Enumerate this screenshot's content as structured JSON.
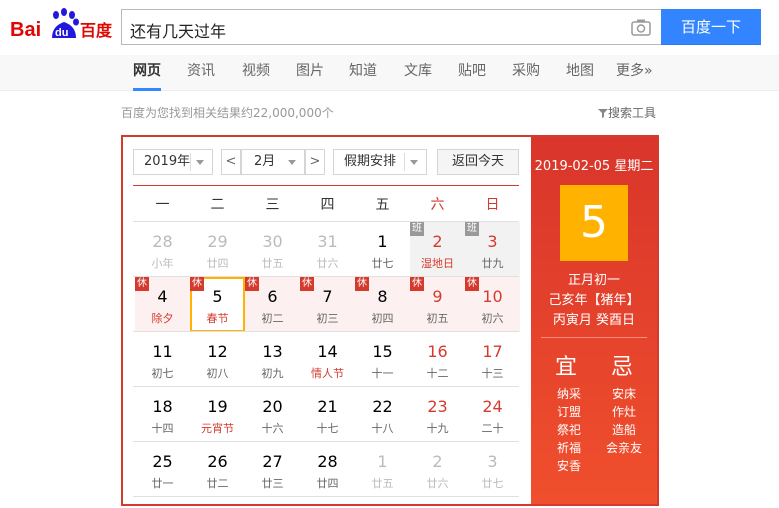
{
  "header": {
    "logo_text_bai": "Bai",
    "logo_text_du": "du",
    "logo_text_cn": "百度",
    "search_value": "还有几天过年",
    "search_button": "百度一下"
  },
  "tabs": [
    "网页",
    "资讯",
    "视频",
    "图片",
    "知道",
    "文库",
    "贴吧",
    "采购",
    "地图",
    "更多»"
  ],
  "result_count": "百度为您找到相关结果约22,000,000个",
  "search_tools": "搜索工具",
  "calendar": {
    "year_select": "2019年",
    "month_select": "2月",
    "prev": "<",
    "next": ">",
    "holiday_select": "假期安排",
    "today_button": "返回今天",
    "weekdays": [
      "一",
      "二",
      "三",
      "四",
      "五",
      "六",
      "日"
    ],
    "weeks": [
      [
        {
          "num": "28",
          "lunar": "小年",
          "other": true
        },
        {
          "num": "29",
          "lunar": "廿四",
          "other": true
        },
        {
          "num": "30",
          "lunar": "廿五",
          "other": true
        },
        {
          "num": "31",
          "lunar": "廿六",
          "other": true
        },
        {
          "num": "1",
          "lunar": "廿七"
        },
        {
          "num": "2",
          "lunar": "湿地日",
          "badge": "班",
          "fest": true
        },
        {
          "num": "3",
          "lunar": "廿九",
          "badge": "班"
        }
      ],
      [
        {
          "num": "4",
          "lunar": "除夕",
          "badge": "休",
          "fest": true
        },
        {
          "num": "5",
          "lunar": "春节",
          "badge": "休",
          "fest": true,
          "selected": true
        },
        {
          "num": "6",
          "lunar": "初二",
          "badge": "休"
        },
        {
          "num": "7",
          "lunar": "初三",
          "badge": "休"
        },
        {
          "num": "8",
          "lunar": "初四",
          "badge": "休"
        },
        {
          "num": "9",
          "lunar": "初五",
          "badge": "休"
        },
        {
          "num": "10",
          "lunar": "初六",
          "badge": "休"
        }
      ],
      [
        {
          "num": "11",
          "lunar": "初七"
        },
        {
          "num": "12",
          "lunar": "初八"
        },
        {
          "num": "13",
          "lunar": "初九"
        },
        {
          "num": "14",
          "lunar": "情人节",
          "fest": true
        },
        {
          "num": "15",
          "lunar": "十一"
        },
        {
          "num": "16",
          "lunar": "十二"
        },
        {
          "num": "17",
          "lunar": "十三"
        }
      ],
      [
        {
          "num": "18",
          "lunar": "十四"
        },
        {
          "num": "19",
          "lunar": "元宵节",
          "fest": true
        },
        {
          "num": "20",
          "lunar": "十六"
        },
        {
          "num": "21",
          "lunar": "十七"
        },
        {
          "num": "22",
          "lunar": "十八"
        },
        {
          "num": "23",
          "lunar": "十九"
        },
        {
          "num": "24",
          "lunar": "二十"
        }
      ],
      [
        {
          "num": "25",
          "lunar": "廿一"
        },
        {
          "num": "26",
          "lunar": "廿二"
        },
        {
          "num": "27",
          "lunar": "廿三"
        },
        {
          "num": "28",
          "lunar": "廿四"
        },
        {
          "num": "1",
          "lunar": "廿五",
          "other": true
        },
        {
          "num": "2",
          "lunar": "廿六",
          "other": true
        },
        {
          "num": "3",
          "lunar": "廿七",
          "other": true
        }
      ]
    ],
    "side": {
      "date": "2019-02-05 星期二",
      "big_day": "5",
      "lunar_date": "正月初一",
      "ganzhi_year": "己亥年【猪年】",
      "ganzhi_month_day": "丙寅月 癸酉日",
      "yi_title": "宜",
      "ji_title": "忌",
      "yi_items": [
        "纳采",
        "订盟",
        "祭祀",
        "祈福",
        "安香"
      ],
      "ji_items": [
        "安床",
        "作灶",
        "造船",
        "会亲友"
      ]
    }
  },
  "colors": {
    "brand_blue": "#3385ff",
    "calendar_red": "#d43b2d",
    "highlight_yellow": "#ffb200"
  }
}
